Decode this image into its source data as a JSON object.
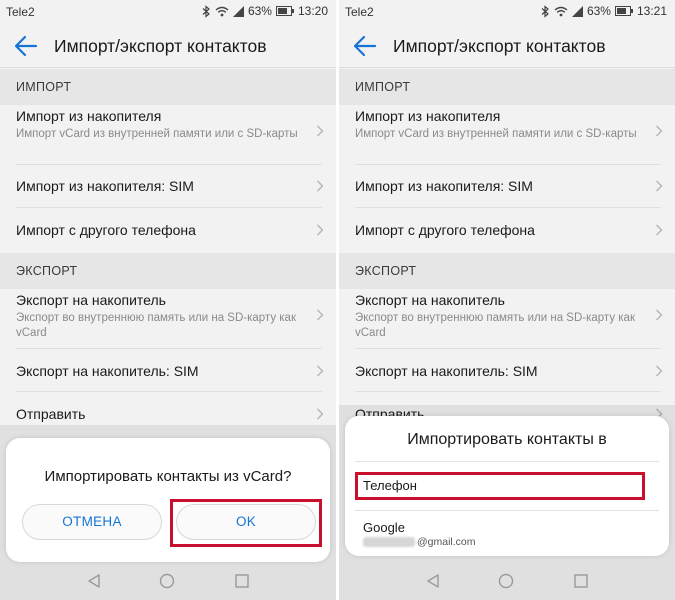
{
  "screens": [
    {
      "status": {
        "carrier": "Tele2",
        "battery": "63%",
        "time": "13:20"
      },
      "app_bar": {
        "title": "Импорт/экспорт контактов"
      },
      "import_header": "ИМПОРТ",
      "items": [
        {
          "title": "Импорт из накопителя",
          "subtitle": "Импорт vCard из внутренней памяти или с SD-карты"
        },
        {
          "title": "Импорт из накопителя: SIM"
        },
        {
          "title": "Импорт с другого телефона"
        }
      ],
      "export_header": "ЭКСПОРТ",
      "export_items": [
        {
          "title": "Экспорт на накопитель",
          "subtitle": "Экспорт во внутреннюю память или на SD-карту как vCard"
        },
        {
          "title": "Экспорт на накопитель: SIM"
        },
        {
          "title": "Отправить"
        }
      ],
      "dialog": {
        "question": "Импортировать контакты из vCard?",
        "cancel_label": "ОТМЕНА",
        "ok_label": "OK"
      }
    },
    {
      "status": {
        "carrier": "Tele2",
        "battery": "63%",
        "time": "13:21"
      },
      "app_bar": {
        "title": "Импорт/экспорт контактов"
      },
      "import_header": "ИМПОРТ",
      "items": [
        {
          "title": "Импорт из накопителя",
          "subtitle": "Импорт vCard из внутренней памяти или с SD-карты"
        },
        {
          "title": "Импорт из накопителя: SIM"
        },
        {
          "title": "Импорт с другого телефона"
        }
      ],
      "export_header": "ЭКСПОРТ",
      "export_items": [
        {
          "title": "Экспорт на накопитель",
          "subtitle": "Экспорт во внутреннюю память или на SD-карту как vCard"
        },
        {
          "title": "Экспорт на накопитель: SIM"
        },
        {
          "title": "Отправить"
        }
      ],
      "dialog": {
        "title": "Импортировать контакты в",
        "option_phone": "Телефон",
        "option_google": "Google",
        "google_email": "@gmail.com"
      }
    }
  ],
  "colors": {
    "accent": "#1674d6",
    "highlight": "#c8102e",
    "section_bg": "#e6e6e6",
    "background": "#f2f2f2"
  },
  "icons": [
    "back-arrow-icon",
    "bluetooth-icon",
    "wifi-icon",
    "signal-icon",
    "battery-icon",
    "chevron-right-icon",
    "nav-back-icon",
    "nav-home-icon",
    "nav-recent-icon"
  ]
}
